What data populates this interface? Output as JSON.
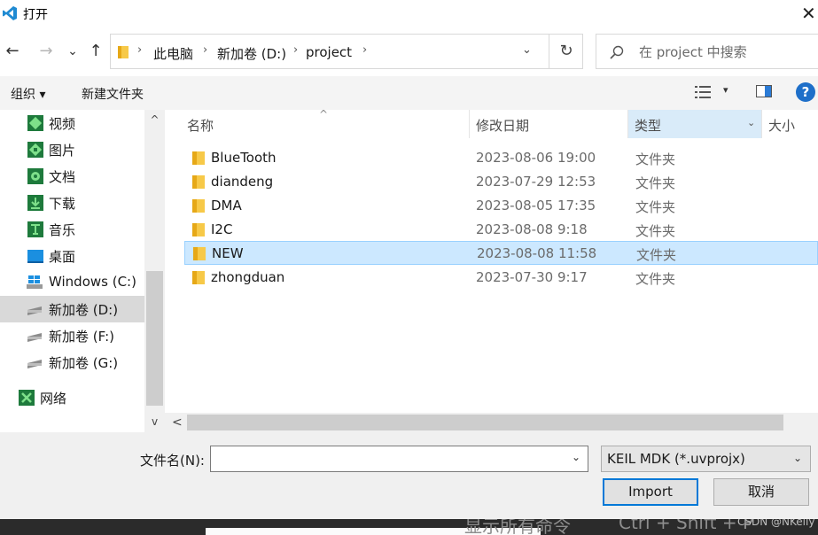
{
  "window": {
    "title": "打开",
    "close_glyph": "✕",
    "accent": "#0078d7"
  },
  "nav": {
    "back_glyph": "←",
    "forward_glyph": "→",
    "recent_glyph": "⌄",
    "up_glyph": "↑",
    "breadcrumb": [
      "此电脑",
      "新加卷 (D:)",
      "project"
    ],
    "crumb_sep": "›",
    "refresh_glyph": "↻",
    "dropdown_glyph": "⌄",
    "search_placeholder": "在 project 中搜索"
  },
  "toolbar": {
    "organize_label": "组织 ▾",
    "new_folder_label": "新建文件夹",
    "view_drop_glyph": "▾",
    "help_glyph": "?"
  },
  "sidebar": {
    "items": [
      {
        "label": "视频",
        "icon": "video-folder-icon"
      },
      {
        "label": "图片",
        "icon": "pictures-folder-icon"
      },
      {
        "label": "文档",
        "icon": "documents-folder-icon"
      },
      {
        "label": "下载",
        "icon": "downloads-folder-icon"
      },
      {
        "label": "音乐",
        "icon": "music-folder-icon"
      },
      {
        "label": "桌面",
        "icon": "desktop-folder-icon"
      },
      {
        "label": "Windows (C:)",
        "icon": "windows-drive-icon"
      },
      {
        "label": "新加卷 (D:)",
        "icon": "drive-icon",
        "selected": true
      },
      {
        "label": "新加卷 (F:)",
        "icon": "drive-icon"
      },
      {
        "label": "新加卷 (G:)",
        "icon": "drive-icon"
      },
      {
        "label": "网络",
        "icon": "network-icon"
      }
    ],
    "scroll_up_glyph": "^",
    "scroll_down_glyph": "v"
  },
  "filelist": {
    "columns": [
      "名称",
      "修改日期",
      "类型",
      "大小"
    ],
    "sort_glyph": "^",
    "type_drop_glyph": "⌄",
    "rows": [
      {
        "name": "BlueTooth",
        "date": "2023-08-06 19:00",
        "type": "文件夹"
      },
      {
        "name": "diandeng",
        "date": "2023-07-29 12:53",
        "type": "文件夹"
      },
      {
        "name": "DMA",
        "date": "2023-08-05 17:35",
        "type": "文件夹"
      },
      {
        "name": "I2C",
        "date": "2023-08-08 9:18",
        "type": "文件夹"
      },
      {
        "name": "NEW",
        "date": "2023-08-08 11:58",
        "type": "文件夹",
        "selected": true
      },
      {
        "name": "zhongduan",
        "date": "2023-07-30 9:17",
        "type": "文件夹"
      }
    ],
    "hscroll_left_glyph": "<"
  },
  "footer": {
    "filename_label": "文件名(N):",
    "filename_value": "",
    "filename_drop_glyph": "⌄",
    "filter_value": "KEIL MDK (*.uvprojx)",
    "filter_drop_glyph": "⌄",
    "import_label": "Import",
    "cancel_label": "取消"
  },
  "background": {
    "text_fragment": "显示所有命令",
    "shortcut": "Ctrl + Shift + P",
    "watermark": "CSDN @NKelly"
  }
}
